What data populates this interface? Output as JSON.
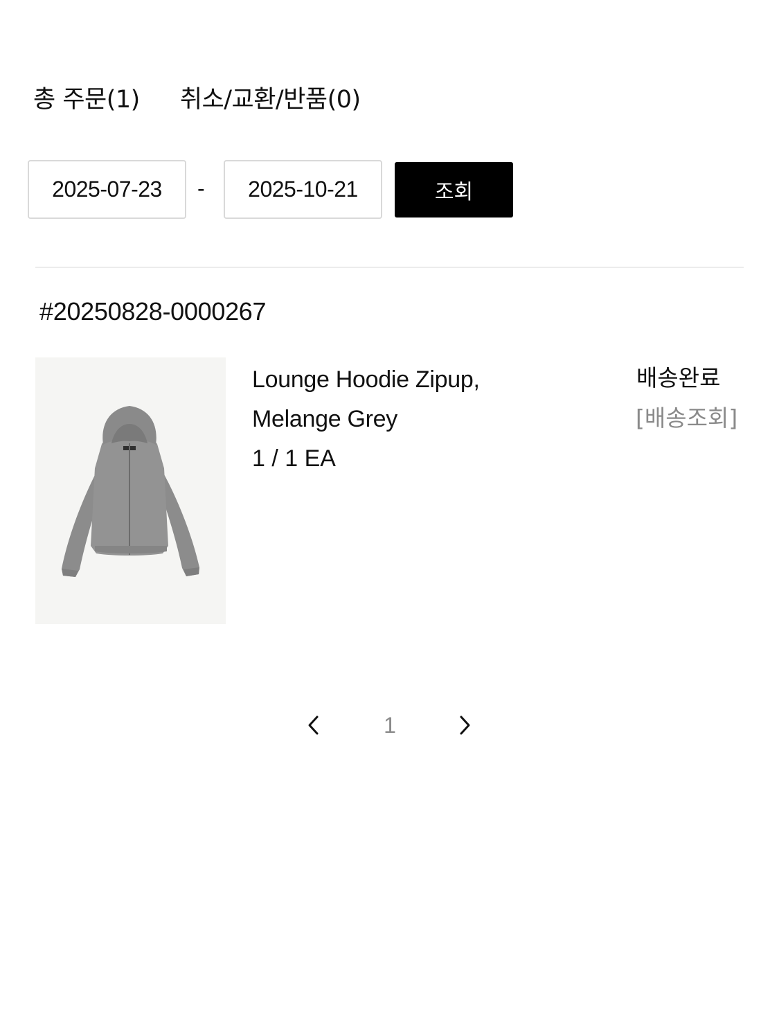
{
  "tabs": [
    {
      "label": "총 주문(1)"
    },
    {
      "label": "취소/교환/반품(0)"
    }
  ],
  "filter": {
    "date_from": "2025-07-23",
    "date_to": "2025-10-21",
    "separator": "-",
    "search_label": "조회"
  },
  "order": {
    "number": "#20250828-0000267",
    "item": {
      "name_line1": "Lounge Hoodie Zipup,",
      "name_line2": "Melange Grey",
      "quantity": "1 / 1 EA",
      "image": "grey-zip-hoodie",
      "status": "배송완료",
      "tracking_label": "[배송조회]"
    }
  },
  "pagination": {
    "current": "1",
    "prev_icon": "chevron-left-icon",
    "next_icon": "chevron-right-icon"
  },
  "colors": {
    "button_bg": "#000000",
    "muted_text": "#8a8a8a",
    "border": "#d9d9d9",
    "thumb_bg": "#f5f5f3",
    "hoodie": "#8f8f8f"
  }
}
